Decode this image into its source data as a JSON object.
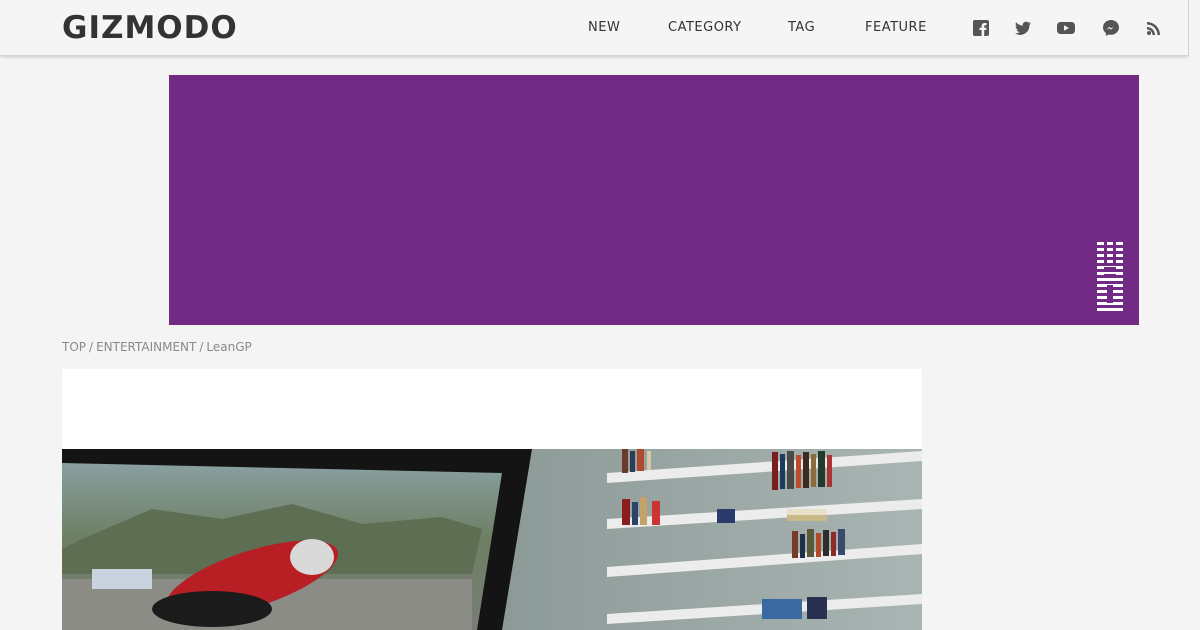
{
  "header": {
    "logo": "GIZMODO",
    "nav": [
      {
        "id": "new",
        "label": "NEW"
      },
      {
        "id": "category",
        "label": "CATEGORY"
      },
      {
        "id": "tag",
        "label": "TAG"
      },
      {
        "id": "feature",
        "label": "FEATURE"
      }
    ],
    "social_icons": [
      "facebook-icon",
      "twitter-icon",
      "youtube-icon",
      "messenger-icon",
      "rss-icon"
    ]
  },
  "ad": {
    "background_color": "#722b85",
    "logo": "IBM"
  },
  "breadcrumb": {
    "items": [
      "TOP",
      "ENTERTAINMENT",
      "LeanGP"
    ],
    "separator": "/"
  },
  "colors": {
    "header_bg": "#f5f5f5",
    "page_bg": "#f4f4f4",
    "text_dark": "#333333",
    "breadcrumb_text": "#8a8a8a"
  }
}
